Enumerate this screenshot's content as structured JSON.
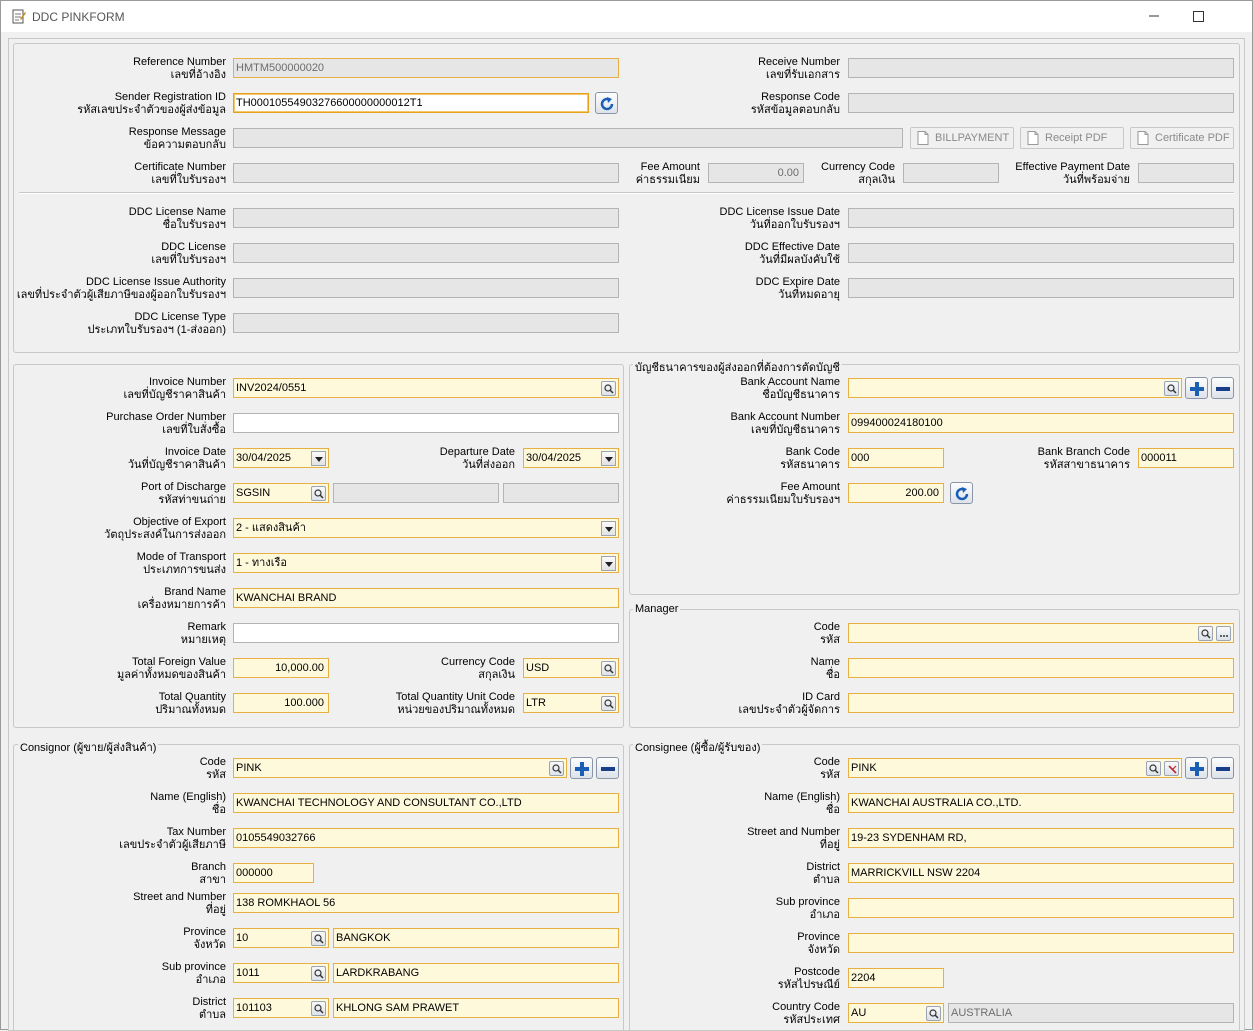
{
  "window": {
    "title": "DDC PINKFORM"
  },
  "top": {
    "reference_number": {
      "label_en": "Reference Number",
      "label_th": "เลขที่อ้างอิง",
      "value": "HMTM500000020"
    },
    "sender_registration_id": {
      "label_en": "Sender Registration ID",
      "label_th": "รหัสเลขประจำตัวของผู้ส่งข้อมูล",
      "value": "TH00010554903276600000000012T1"
    },
    "response_message": {
      "label_en": "Response Message",
      "label_th": "ข้อความตอบกลับ",
      "value": ""
    },
    "certificate_number": {
      "label_en": "Certificate Number",
      "label_th": "เลขที่ใบรับรองฯ",
      "value": ""
    },
    "receive_number": {
      "label_en": "Receive Number",
      "label_th": "เลขที่รับเอกสาร",
      "value": ""
    },
    "response_code": {
      "label_en": "Response Code",
      "label_th": "รหัสข้อมูลตอบกลับ",
      "value": ""
    },
    "fee_amount": {
      "label_en": "Fee Amount",
      "label_th": "ค่าธรรมเนียม",
      "value": "0.00"
    },
    "currency_code": {
      "label_en": "Currency Code",
      "label_th": "สกุลเงิน",
      "value": ""
    },
    "effective_payment_date": {
      "label_en": "Effective Payment Date",
      "label_th": "วันที่พร้อมจ่าย",
      "value": ""
    },
    "billpayment_label": "BILLPAYMENT",
    "receipt_pdf_label": "Receipt PDF",
    "certificate_pdf_label": "Certificate PDF"
  },
  "license": {
    "name": {
      "label_en": "DDC License Name",
      "label_th": "ชื่อใบรับรองฯ"
    },
    "number": {
      "label_en": "DDC License",
      "label_th": "เลขที่ใบรับรองฯ"
    },
    "authority": {
      "label_en": "DDC License Issue Authority",
      "label_th": "เลขที่ประจำตัวผู้เสียภาษีของผู้ออกใบรับรองฯ"
    },
    "type": {
      "label_en": "DDC License Type",
      "label_th": "ประเภทใบรับรองฯ (1-ส่งออก)"
    },
    "issue_date": {
      "label_en": "DDC License Issue Date",
      "label_th": "วันที่ออกใบรับรองฯ"
    },
    "effective_date": {
      "label_en": "DDC Effective Date",
      "label_th": "วันที่มีผลบังคับใช้"
    },
    "expire_date": {
      "label_en": "DDC Expire Date",
      "label_th": "วันที่หมดอายุ"
    }
  },
  "invoice": {
    "invoice_number": {
      "label_en": "Invoice Number",
      "label_th": "เลขที่บัญชีราคาสินค้า",
      "value": "INV2024/0551"
    },
    "purchase_order": {
      "label_en": "Purchase Order Number",
      "label_th": "เลขที่ใบสั่งซื้อ",
      "value": ""
    },
    "invoice_date": {
      "label_en": "Invoice Date",
      "label_th": "วันที่บัญชีราคาสินค้า",
      "value": "30/04/2025"
    },
    "departure_date": {
      "label_en": "Departure Date",
      "label_th": "วันที่ส่งออก",
      "value": "30/04/2025"
    },
    "port_of_discharge": {
      "label_en": "Port of Discharge",
      "label_th": "รหัสท่าขนถ่าย",
      "value": "SGSIN"
    },
    "objective": {
      "label_en": "Objective of Export",
      "label_th": "วัตถุประสงค์ในการส่งออก",
      "value": "2 - แสดงสินค้า"
    },
    "mode_of_transport": {
      "label_en": "Mode of Transport",
      "label_th": "ประเภทการขนส่ง",
      "value": "1 - ทางเรือ"
    },
    "brand_name": {
      "label_en": "Brand Name",
      "label_th": "เครื่องหมายการค้า",
      "value": "KWANCHAI BRAND"
    },
    "remark": {
      "label_en": "Remark",
      "label_th": "หมายเหตุ",
      "value": ""
    },
    "total_foreign_value": {
      "label_en": "Total Foreign Value",
      "label_th": "มูลค่าทั้งหมดของสินค้า",
      "value": "10,000.00"
    },
    "currency_code": {
      "label_en": "Currency Code",
      "label_th": "สกุลเงิน",
      "value": "USD"
    },
    "total_quantity": {
      "label_en": "Total Quantity",
      "label_th": "ปริมาณทั้งหมด",
      "value": "100.000"
    },
    "quantity_unit": {
      "label_en": "Total Quantity Unit Code",
      "label_th": "หน่วยของปริมาณทั้งหมด",
      "value": "LTR"
    }
  },
  "bank": {
    "legend": "บัญชีธนาคารของผู้ส่งออกที่ต้องการตัดบัญชี",
    "account_name": {
      "label_en": "Bank Account Name",
      "label_th": "ชื่อบัญชีธนาคาร",
      "value": ""
    },
    "account_number": {
      "label_en": "Bank Account Number",
      "label_th": "เลขที่บัญชีธนาคาร",
      "value": "099400024180100"
    },
    "bank_code": {
      "label_en": "Bank Code",
      "label_th": "รหัสธนาคาร",
      "value": "000"
    },
    "branch_code": {
      "label_en": "Bank Branch Code",
      "label_th": "รหัสสาขาธนาคาร",
      "value": "000011"
    },
    "fee_amount": {
      "label_en": "Fee Amount",
      "label_th": "ค่าธรรมเนียมใบรับรองฯ",
      "value": "200.00"
    }
  },
  "manager": {
    "legend": "Manager",
    "code": {
      "label_en": "Code",
      "label_th": "รหัส",
      "value": ""
    },
    "name": {
      "label_en": "Name",
      "label_th": "ชื่อ",
      "value": ""
    },
    "id_card": {
      "label_en": "ID Card",
      "label_th": "เลขประจำตัวผู้จัดการ",
      "value": ""
    }
  },
  "consignor": {
    "legend": "Consignor (ผู้ขาย/ผู้ส่งสินค้า)",
    "code": {
      "label_en": "Code",
      "label_th": "รหัส",
      "value": "PINK"
    },
    "name": {
      "label_en": "Name (English)",
      "label_th": "ชื่อ",
      "value": "KWANCHAI TECHNOLOGY AND CONSULTANT CO.,LTD"
    },
    "tax_number": {
      "label_en": "Tax Number",
      "label_th": "เลขประจำตัวผู้เสียภาษี",
      "value": "0105549032766"
    },
    "branch": {
      "label_en": "Branch",
      "label_th": "สาขา",
      "value": "000000"
    },
    "street": {
      "label_en": "Street and Number",
      "label_th": "ที่อยู่",
      "value": "138 ROMKHAOL 56"
    },
    "province": {
      "label_en": "Province",
      "label_th": "จังหวัด",
      "code": "10",
      "value": "BANGKOK"
    },
    "sub_province": {
      "label_en": "Sub province",
      "label_th": "อำเภอ",
      "code": "1011",
      "value": "LARDKRABANG"
    },
    "district": {
      "label_en": "District",
      "label_th": "ตำบล",
      "code": "101103",
      "value": "KHLONG SAM PRAWET"
    }
  },
  "consignee": {
    "legend": "Consignee (ผู้ซื้อ/ผู้รับของ)",
    "code": {
      "label_en": "Code",
      "label_th": "รหัส",
      "value": "PINK"
    },
    "name": {
      "label_en": "Name (English)",
      "label_th": "ชื่อ",
      "value": "KWANCHAI AUSTRALIA CO.,LTD."
    },
    "street": {
      "label_en": "Street and Number",
      "label_th": "ที่อยู่",
      "value": "19-23 SYDENHAM RD,"
    },
    "district": {
      "label_en": "District",
      "label_th": "ตำบล",
      "value": "MARRICKVILL NSW 2204"
    },
    "sub_province": {
      "label_en": "Sub province",
      "label_th": "อำเภอ",
      "value": ""
    },
    "province": {
      "label_en": "Province",
      "label_th": "จังหวัด",
      "value": ""
    },
    "postcode": {
      "label_en": "Postcode",
      "label_th": "รหัสไปรษณีย์",
      "value": "2204"
    },
    "country": {
      "label_en": "Country Code",
      "label_th": "รหัสประเทศ",
      "code": "AU",
      "value": "AUSTRALIA"
    }
  },
  "icons": [
    "form-app-icon",
    "minimize-icon",
    "maximize-icon",
    "search-icon",
    "dropdown-arrow-icon",
    "refresh-icon",
    "plus-icon",
    "minus-icon",
    "pdf-document-icon",
    "ellipsis-icon",
    "clear-icon"
  ],
  "colors": {
    "required_bg": "#fff9dc",
    "required_border": "#e6b045",
    "readonly_bg": "#e6e6e6",
    "button_icon_blue": "#1a5fb4"
  }
}
